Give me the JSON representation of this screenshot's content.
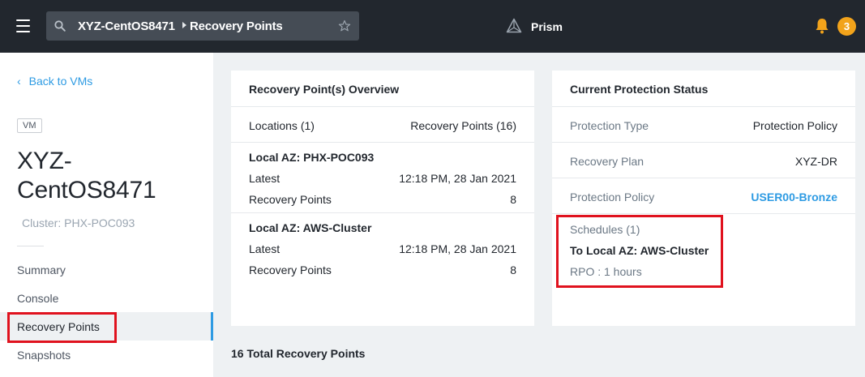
{
  "header": {
    "breadcrumb_vm": "XYZ-CentOS8471",
    "breadcrumb_page": "Recovery Points",
    "app_name": "Prism",
    "notification_count": "3"
  },
  "sidebar": {
    "back_label": "Back to VMs",
    "entity_type": "VM",
    "vm_name": "XYZ-CentOS8471",
    "cluster": "Cluster: PHX-POC093",
    "nav": [
      {
        "label": "Summary"
      },
      {
        "label": "Console"
      },
      {
        "label": "Recovery Points"
      },
      {
        "label": "Snapshots"
      }
    ]
  },
  "overview": {
    "title": "Recovery Point(s) Overview",
    "locations_label": "Locations (1)",
    "rp_total_label": "Recovery Points (16)",
    "groups": [
      {
        "name": "Local AZ: PHX-POC093",
        "latest_label": "Latest",
        "latest_value": "12:18 PM, 28 Jan 2021",
        "count_label": "Recovery Points",
        "count_value": "8"
      },
      {
        "name": "Local AZ: AWS-Cluster",
        "latest_label": "Latest",
        "latest_value": "12:18 PM, 28 Jan 2021",
        "count_label": "Recovery Points",
        "count_value": "8"
      }
    ]
  },
  "protection": {
    "title": "Current Protection Status",
    "rows": [
      {
        "label": "Protection Type",
        "value": "Protection Policy"
      },
      {
        "label": "Recovery Plan",
        "value": "XYZ-DR"
      },
      {
        "label": "Protection Policy",
        "value": "USER00-Bronze"
      }
    ],
    "schedules_label": "Schedules (1)",
    "schedule_target": "To Local AZ: AWS-Cluster",
    "schedule_rpo": "RPO : 1 hours"
  },
  "footer": {
    "total_label": "16 Total Recovery Points"
  },
  "colors": {
    "accent": "#2e9be3",
    "topbar": "#22272e",
    "badge": "#f2a31b",
    "highlight": "#e0121e"
  },
  "icons": [
    "hamburger-icon",
    "search-icon",
    "chevron-right-icon",
    "star-icon",
    "prism-logo-icon",
    "bell-icon",
    "chevron-left-icon"
  ]
}
